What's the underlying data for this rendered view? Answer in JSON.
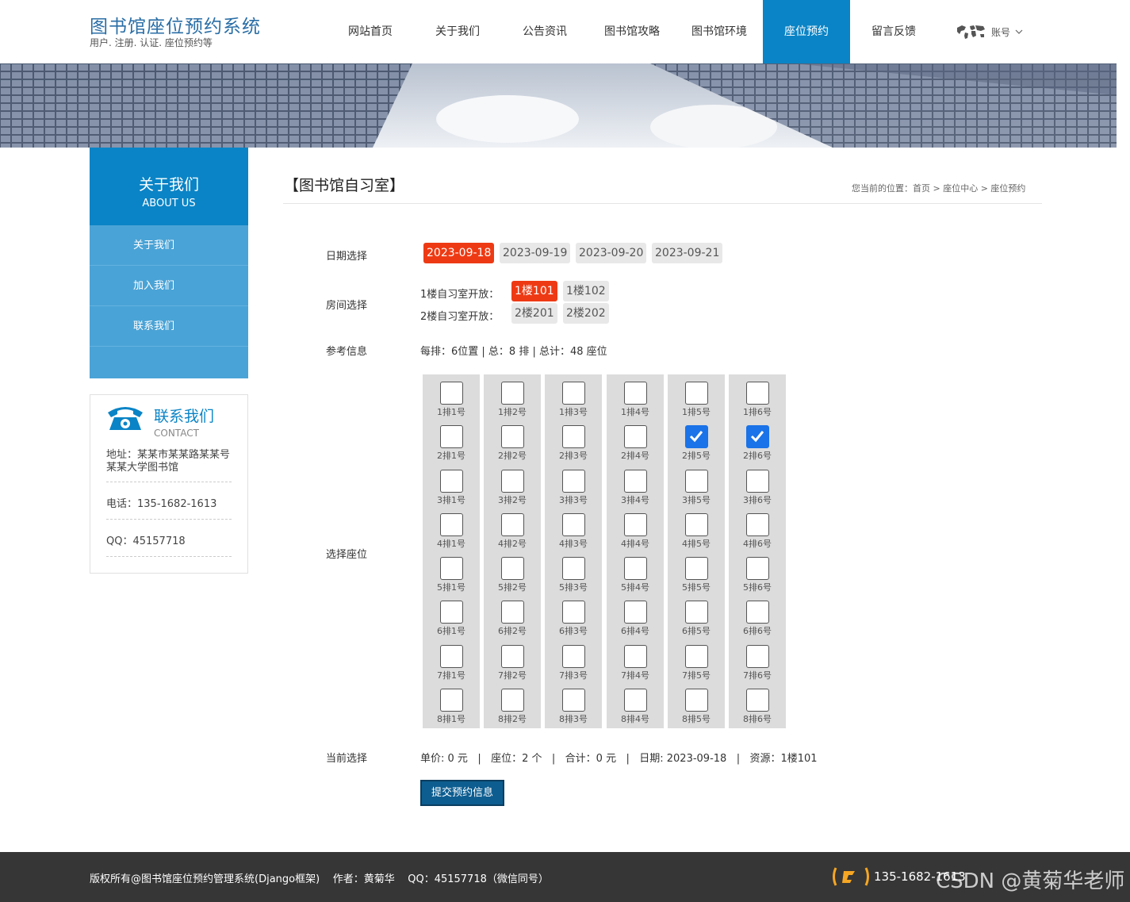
{
  "brand": {
    "title": "图书馆座位预约系统",
    "subtitle": "用户. 注册. 认证. 座位预约等"
  },
  "nav": [
    {
      "label": "网站首页"
    },
    {
      "label": "关于我们"
    },
    {
      "label": "公告资讯"
    },
    {
      "label": "图书馆攻略"
    },
    {
      "label": "图书馆环境"
    },
    {
      "label": "座位预约",
      "active": true
    },
    {
      "label": "留言反馈"
    }
  ],
  "account": {
    "label": "账号",
    "icon": "world-map-icon"
  },
  "sidebar": {
    "title": "关于我们",
    "title_en": "ABOUT US",
    "items": [
      {
        "label": "关于我们"
      },
      {
        "label": "加入我们"
      },
      {
        "label": "联系我们"
      }
    ]
  },
  "contact": {
    "title": "联系我们",
    "subtitle": "CONTACT",
    "address": "地址：某某市某某路某某号某某大学图书馆",
    "phone": "电话：135-1682-1613",
    "qq": "QQ：45157718"
  },
  "main": {
    "title": "【图书馆自习室】",
    "breadcrumb": "您当前的位置：首页 > 座位中心 > 座位预约",
    "date_label": "日期选择",
    "dates": [
      "2023-09-18",
      "2023-09-19",
      "2023-09-20",
      "2023-09-21"
    ],
    "room_label": "房间选择",
    "floor1_label": "1楼自习室开放：",
    "floor1_rooms": [
      "1楼101",
      "1楼102"
    ],
    "floor2_label": "2楼自习室开放：",
    "floor2_rooms": [
      "2楼201",
      "2楼202"
    ],
    "ref_label": "参考信息",
    "ref_text": "每排：6位置 | 总：8 排 | 总计：48 座位",
    "seat_label": "选择座位",
    "current_label": "当前选择",
    "current_text": "单价: 0 元   |   座位：2 个   |   合计：0 元   |   日期: 2023-09-18   |   资源：1楼101",
    "submit_label": "提交预约信息"
  },
  "seats": {
    "rows": 8,
    "cols": 6,
    "checked": [
      "2-5",
      "2-6"
    ]
  },
  "footer": {
    "text": "版权所有@图书馆座位预约管理系统(Django框架)    作者：黄菊华    QQ：45157718（微信同号）",
    "phone": "135-1682-1613",
    "watermark": "CSDN @黄菊华老师"
  },
  "colors": {
    "accent": "#0a84c6",
    "selected": "#ee3a14",
    "footer": "#363636"
  }
}
